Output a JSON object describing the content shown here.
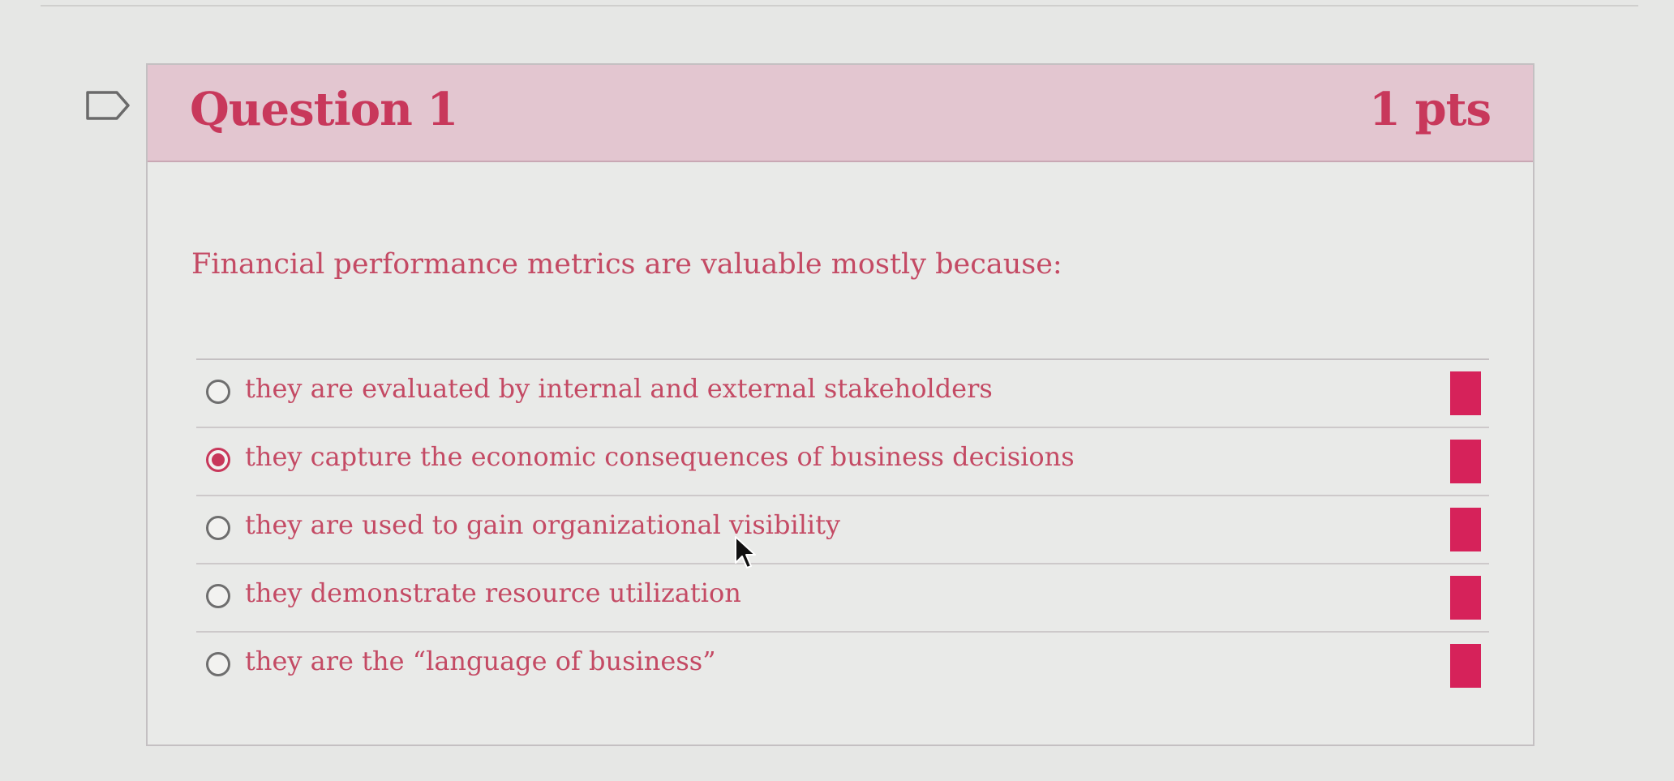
{
  "question": {
    "title": "Question 1",
    "points": "1 pts",
    "prompt": "Financial performance metrics are valuable mostly because:"
  },
  "answers": [
    {
      "label": "they are evaluated by internal and external stakeholders",
      "selected": false
    },
    {
      "label": "they capture the economic consequences of business decisions",
      "selected": true
    },
    {
      "label": "they are used to gain organizational visibility",
      "selected": false
    },
    {
      "label": "they demonstrate resource utilization",
      "selected": false
    },
    {
      "label": "they are the “language of business”",
      "selected": false
    }
  ],
  "icons": {
    "flag": "flag-outline-icon",
    "cursor": "mouse-pointer-icon"
  },
  "colors": {
    "accent": "#c8385b",
    "header_bg": "#e3c6d0",
    "marker": "#d6225a"
  }
}
